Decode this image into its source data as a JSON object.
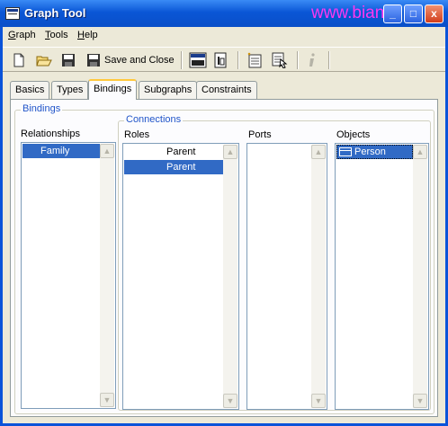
{
  "window": {
    "title": "Graph Tool",
    "watermark": "www.bian",
    "controls": {
      "minimize": "_",
      "maximize": "□",
      "close": "x"
    }
  },
  "menu": {
    "graph": {
      "label": "Graph",
      "mnemonic": "G",
      "rest": "raph"
    },
    "tools": {
      "label": "Tools",
      "mnemonic": "T",
      "rest": "ools"
    },
    "help": {
      "label": "Help",
      "mnemonic": "H",
      "rest": "elp"
    }
  },
  "toolbar": {
    "save_close_label": "Save and Close",
    "icons": [
      "new-icon",
      "open-icon",
      "save-icon",
      "save-and-close-icon",
      "xml-export-icon",
      "properties-icon",
      "new-item-icon",
      "select-icon",
      "info-icon"
    ]
  },
  "tabs": [
    {
      "label": "Basics"
    },
    {
      "label": "Types"
    },
    {
      "label": "Bindings",
      "active": true
    },
    {
      "label": "Subgraphs"
    },
    {
      "label": "Constraints"
    }
  ],
  "bindings": {
    "group_title": "Bindings",
    "relationships": {
      "label": "Relationships",
      "items": [
        "Family"
      ]
    },
    "connections": {
      "group_title": "Connections",
      "roles": {
        "label": "Roles",
        "items": [
          "Parent",
          "Parent"
        ]
      },
      "ports": {
        "label": "Ports",
        "items": []
      },
      "objects": {
        "label": "Objects",
        "items": [
          "Person"
        ]
      }
    }
  },
  "colors": {
    "titlebar": "#0A56D6",
    "selection": "#316AC5",
    "group_title": "#2155C9",
    "active_tab_accent": "#FFC83C",
    "watermark": "#FF38F0"
  }
}
